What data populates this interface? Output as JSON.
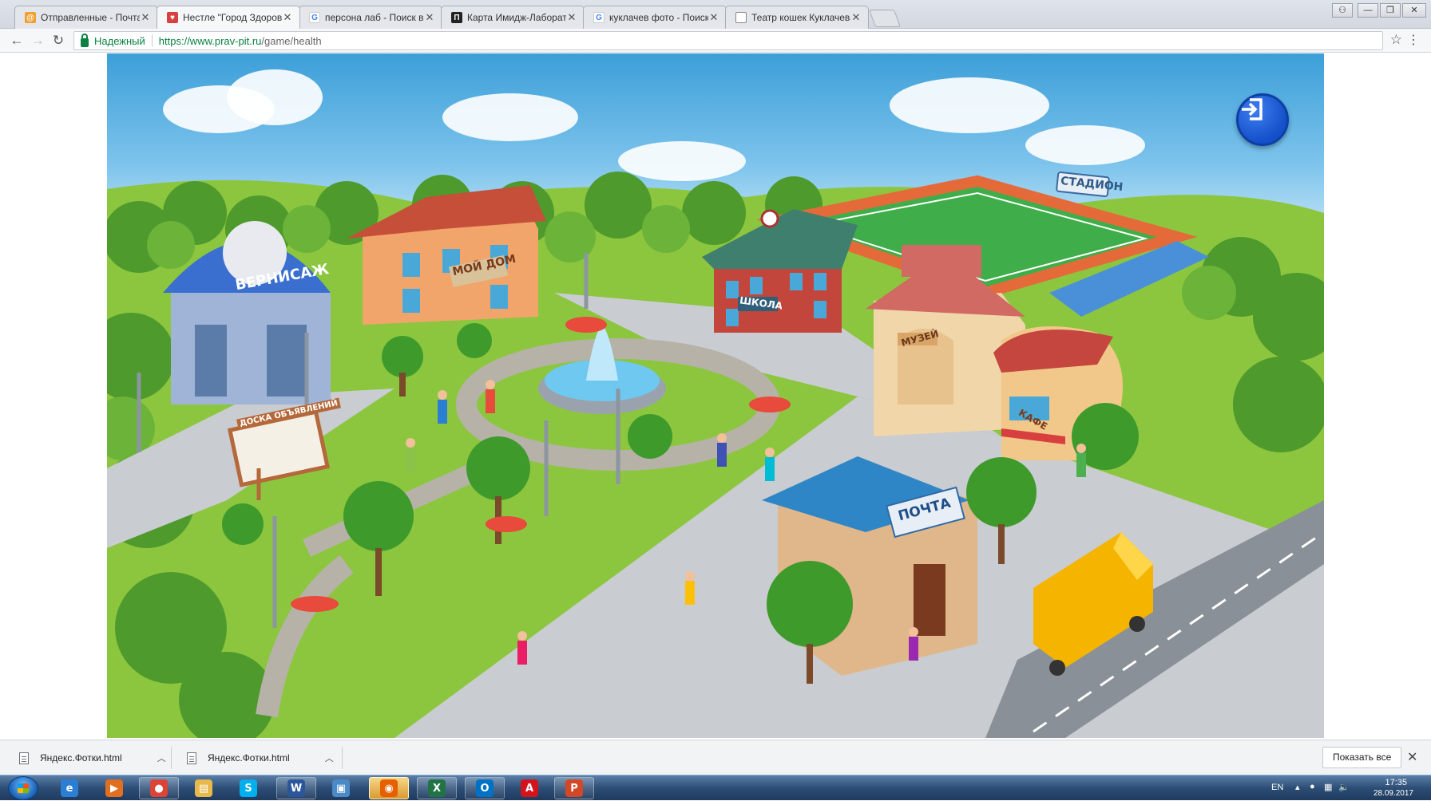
{
  "browser": {
    "tabs": [
      {
        "title": "Отправленные - Почта",
        "favicon": "mail-icon",
        "color": "#f0a030"
      },
      {
        "title": "Нестле \"Город Здоровья\"",
        "favicon": "nestle-icon",
        "color": "#d94040",
        "active": true
      },
      {
        "title": "персона лаб - Поиск в Google",
        "favicon": "google-icon",
        "color": "#4285f4"
      },
      {
        "title": "Карта Имидж-Лаборатории",
        "favicon": "map-icon",
        "color": "#222222"
      },
      {
        "title": "куклачев фото - Поиск в Google",
        "favicon": "google-icon",
        "color": "#4285f4"
      },
      {
        "title": "Театр кошек Куклачева",
        "favicon": "page-icon",
        "color": "#888888"
      }
    ],
    "address": {
      "secure_label": "Надежный",
      "url_host": "https://www.prav-pit.ru",
      "url_path": "/game/health"
    }
  },
  "game": {
    "signs": {
      "gallery": "ВЕРНИСАЖ",
      "home": "МОЙ ДОМ",
      "school": "ШКОЛА",
      "stadium": "СТАДИОН",
      "museum": "МУЗЕЙ",
      "cafe": "КАФЕ",
      "post": "ПОЧТА",
      "board": "ДОСКА ОБЪЯВЛЕНИЙ"
    },
    "exit_icon": "exit-icon",
    "colors": {
      "grass": "#8cc63f",
      "road": "#c9ccd0",
      "exit_button": "#1c5fd8"
    }
  },
  "downloads": {
    "items": [
      {
        "name": "Яндекс.Фотки.html"
      },
      {
        "name": "Яндекс.Фотки.html"
      }
    ],
    "show_all": "Показать все"
  },
  "taskbar": {
    "apps": [
      {
        "name": "ie-icon",
        "label": "e",
        "color": "#2a7fd4"
      },
      {
        "name": "media-player-icon",
        "label": "▶",
        "color": "#e07020"
      },
      {
        "name": "chrome-icon",
        "label": "●",
        "color": "#db4437"
      },
      {
        "name": "explorer-icon",
        "label": "▤",
        "color": "#e8b84a"
      },
      {
        "name": "skype-icon",
        "label": "S",
        "color": "#00aff0"
      },
      {
        "name": "word-icon",
        "label": "W",
        "color": "#2b579a"
      },
      {
        "name": "photo-viewer-icon",
        "label": "▣",
        "color": "#4a8ac9"
      },
      {
        "name": "firefox-icon",
        "label": "◉",
        "color": "#e66000"
      },
      {
        "name": "excel-icon",
        "label": "X",
        "color": "#217346"
      },
      {
        "name": "outlook-icon",
        "label": "O",
        "color": "#0072c6"
      },
      {
        "name": "acrobat-icon",
        "label": "A",
        "color": "#d4141c"
      },
      {
        "name": "powerpoint-icon",
        "label": "P",
        "color": "#d24726"
      }
    ],
    "lang": "EN",
    "time": "17:35",
    "date": "28.09.2017"
  }
}
